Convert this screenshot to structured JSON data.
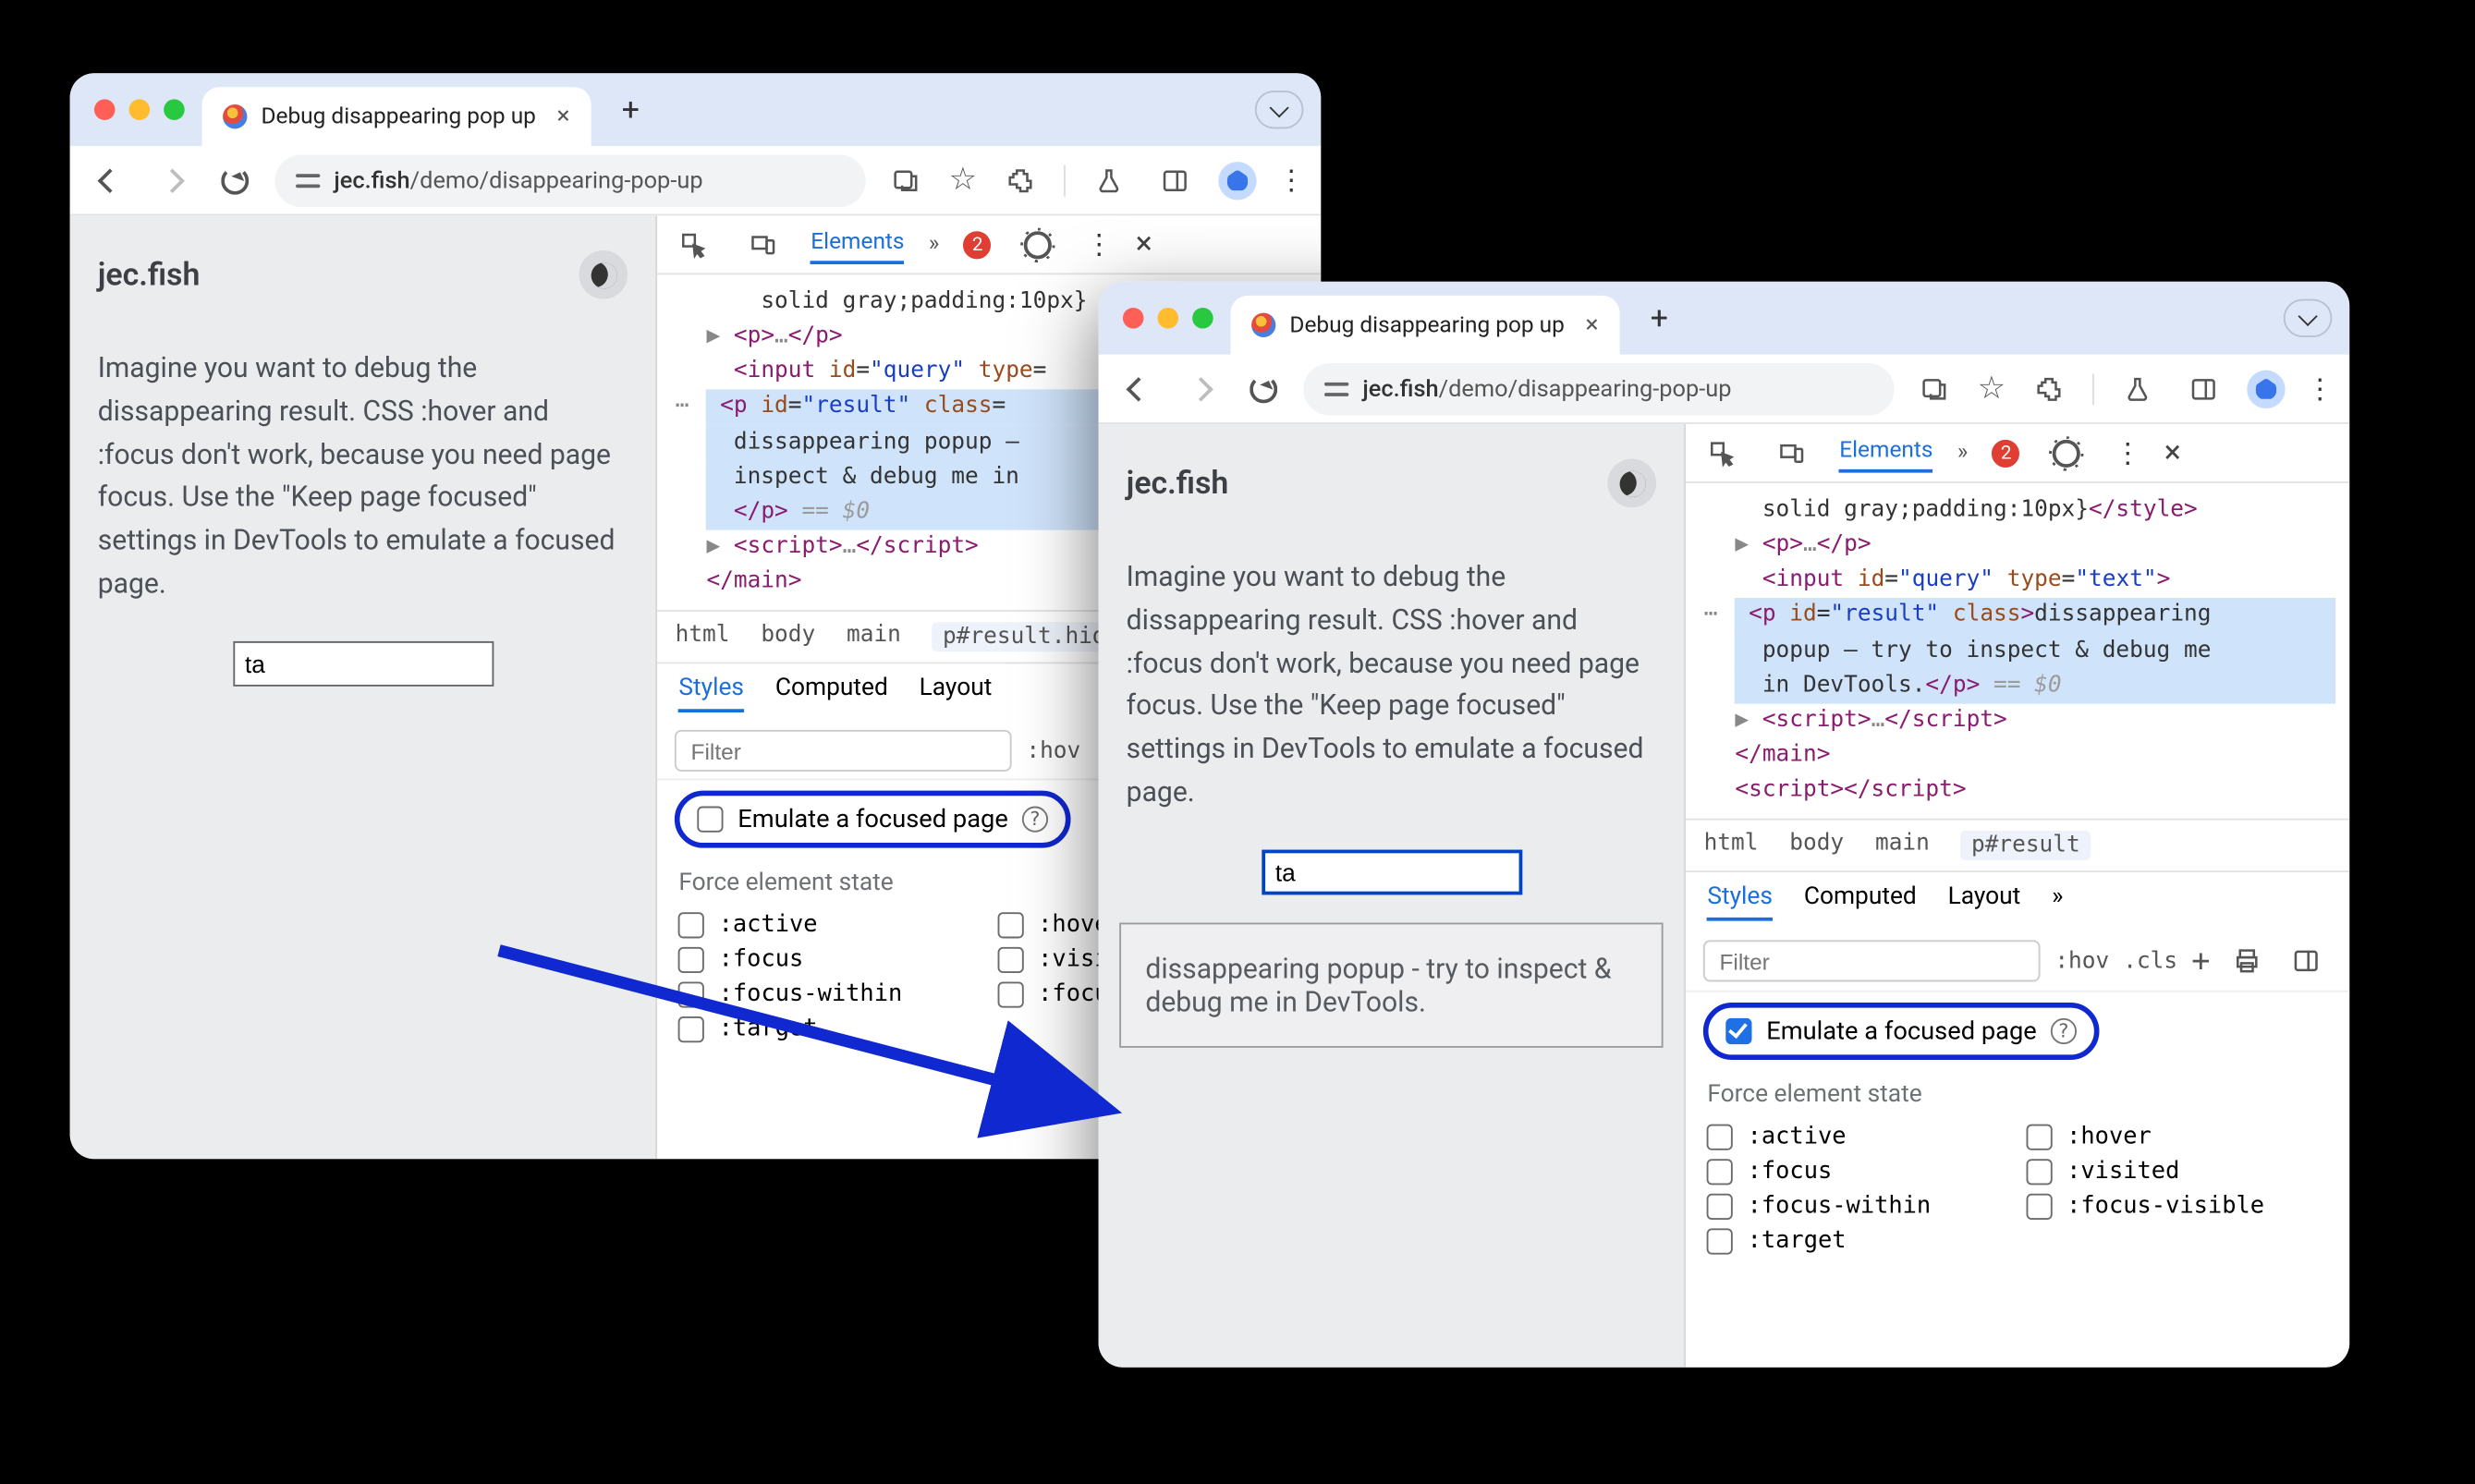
{
  "browser": {
    "tab_title": "Debug disappearing pop up",
    "url_host": "jec.fish",
    "url_path": "/demo/disappearing-pop-up"
  },
  "page": {
    "site_title": "jec.fish",
    "body_text": "Imagine you want to debug the dissappearing result. CSS :hover and :focus don't work, because you need page focus. Use the \"Keep page focused\" settings in DevTools to emulate a focused page.",
    "query_value": "ta",
    "popup_text": "dissappearing popup - try to inspect & debug me in DevTools."
  },
  "devtools": {
    "tabs": {
      "elements": "Elements",
      "more": "»"
    },
    "error_count": "2",
    "dom": {
      "style_frag": "solid gray;padding:10px}",
      "p_open": "<p>",
      "p_ell": "…",
      "p_close": "</p>",
      "input_line": "<input id=\"query\" type=\"text\">",
      "result_open": "<p id=\"result\" class=",
      "result_text1": "dissappearing popup - try to inspect & debug me in DevTools.",
      "result_close": "</p>",
      "eq0": " == $0",
      "script_open": "<script>",
      "script_ell": "…",
      "script_close": "</script>",
      "main_close": "</main>",
      "script2": "<script></script>"
    },
    "breadcrumb": {
      "html": "html",
      "body": "body",
      "main": "main",
      "p_hidden": "p#result.hid",
      "p": "p#result"
    },
    "style_tabs": {
      "styles": "Styles",
      "computed": "Computed",
      "layout": "Layout",
      "more": "»"
    },
    "filter_placeholder": "Filter",
    "hov": ":hov",
    "cls": ".cls",
    "emulate_label": "Emulate a focused page",
    "force_header": "Force element state",
    "states": {
      "active": ":active",
      "hover": ":hover",
      "focus": ":focus",
      "visited": ":visited",
      "focus_within": ":focus-within",
      "focus_visible": ":focus-visible",
      "target": ":target"
    }
  }
}
